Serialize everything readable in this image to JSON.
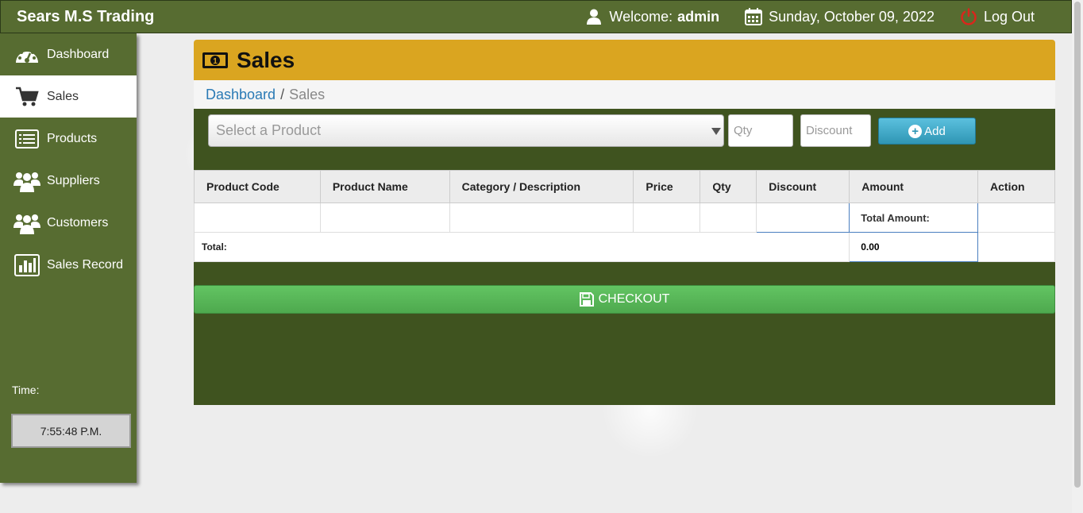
{
  "topbar": {
    "brand": "Sears M.S Trading",
    "welcome_label": "Welcome:",
    "user": "admin",
    "date": "Sunday, October 09, 2022",
    "logout": "Log Out"
  },
  "sidebar": {
    "items": [
      {
        "label": "Dashboard",
        "icon": "dashboard-gauge-icon"
      },
      {
        "label": "Sales",
        "icon": "shopping-cart-icon",
        "active": true
      },
      {
        "label": "Products",
        "icon": "list-icon"
      },
      {
        "label": "Suppliers",
        "icon": "users-icon"
      },
      {
        "label": "Customers",
        "icon": "users-icon"
      },
      {
        "label": "Sales Record",
        "icon": "bar-chart-icon"
      }
    ],
    "time_label": "Time:",
    "time": "7:55:48 P.M."
  },
  "panel": {
    "title": "Sales",
    "breadcrumb": {
      "home": "Dashboard",
      "sep": "/",
      "current": "Sales"
    }
  },
  "form": {
    "product_placeholder": "Select a Product",
    "qty_placeholder": "Qty",
    "discount_placeholder": "Discount",
    "add_label": "Add"
  },
  "table": {
    "headers": [
      "Product Code",
      "Product Name",
      "Category / Description",
      "Price",
      "Qty",
      "Discount",
      "Amount",
      "Action"
    ],
    "total_amount_label": "Total Amount:",
    "total_label": "Total:",
    "total_value": "0.00"
  },
  "checkout_label": "CHECKOUT",
  "colors": {
    "header_green": "#576c31",
    "panel_green": "#3f531f",
    "panel_header_gold": "#daa520",
    "add_blue": "#2f96b4",
    "checkout_green": "#5cb85c"
  }
}
